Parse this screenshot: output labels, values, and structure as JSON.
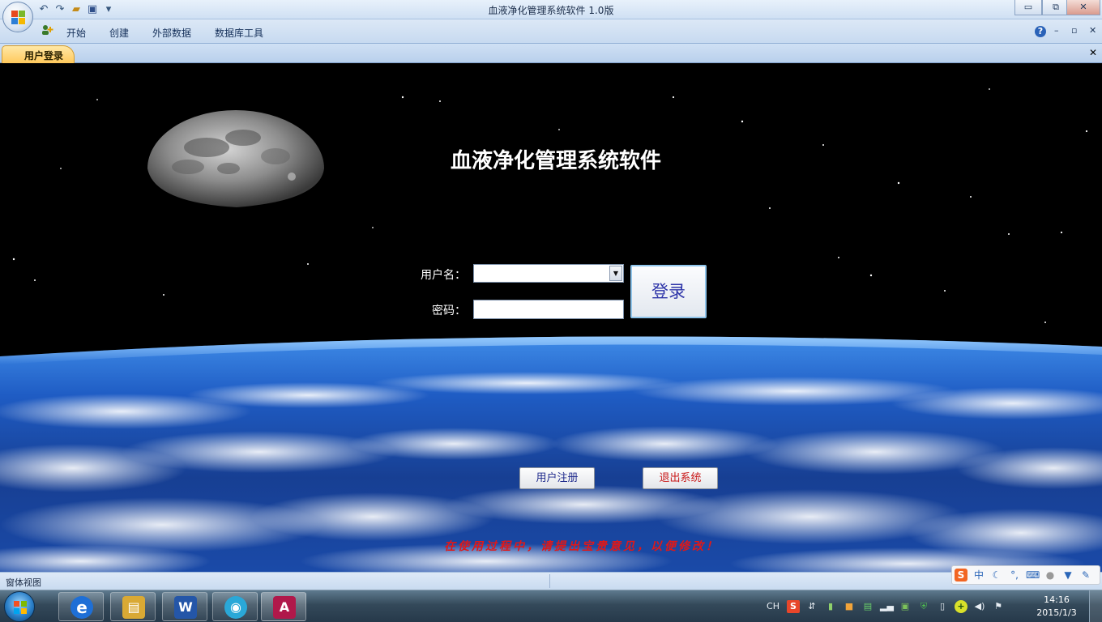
{
  "window": {
    "title": "血液净化管理系统软件 1.0版",
    "controls": {
      "minimize": "▭",
      "restore": "⧉",
      "close": "✕"
    }
  },
  "quick_access": [
    {
      "icon": "undo-icon",
      "glyph": "↶"
    },
    {
      "icon": "redo-icon",
      "glyph": "↷"
    },
    {
      "icon": "open-folder-icon",
      "glyph": "📂"
    },
    {
      "icon": "save-icon",
      "glyph": "💾"
    },
    {
      "icon": "customize-icon",
      "glyph": "▾"
    }
  ],
  "ribbon": {
    "tabs": [
      "开始",
      "创建",
      "外部数据",
      "数据库工具"
    ],
    "help_glyph": "?",
    "minimize_glyph": "–",
    "restore_glyph": "▫",
    "close_glyph": "✕"
  },
  "document_tabs": {
    "active": "用户登录",
    "close_glyph": "✕"
  },
  "form": {
    "title": "血液净化管理系统软件",
    "username_label": "用户名：",
    "password_label": "密码：",
    "username_value": "",
    "password_value": "",
    "login_button": "登录",
    "register_button": "用户注册",
    "exit_button": "退出系统",
    "note": "在使用过程中，请提出宝贵意见，以便修改！"
  },
  "status_bar": {
    "text": "窗体视图"
  },
  "ime_bar": {
    "logo": "S",
    "mode": "中",
    "icons": [
      "moon-icon",
      "punctuation-icon",
      "keyboard-icon",
      "user-icon",
      "skin-icon",
      "settings-icon"
    ]
  },
  "taskbar": {
    "apps": [
      {
        "name": "internet-explorer",
        "glyph": "e",
        "color": "#1e6fd6"
      },
      {
        "name": "file-explorer",
        "glyph": "▤",
        "color": "#d9a934"
      },
      {
        "name": "word",
        "glyph": "W",
        "color": "#2456a8"
      },
      {
        "name": "browser",
        "glyph": "◉",
        "color": "#2aa8d8"
      },
      {
        "name": "access",
        "glyph": "A",
        "color": "#b0184a"
      }
    ],
    "tray": {
      "language": "CH",
      "icons": [
        "sogou-icon",
        "network-switch-icon",
        "battery-icon",
        "app-icon",
        "chat-icon",
        "signal-icon",
        "network-icon",
        "shield-icon",
        "device-icon",
        "plus-icon",
        "volume-icon",
        "flag-icon"
      ]
    },
    "clock_time": "14:16",
    "clock_date": "2015/1/3"
  },
  "colors": {
    "note_red": "#e01818",
    "login_text_blue": "#2d34a8",
    "ribbon_blue": "#c7daf0",
    "active_tab_orange": "#ffc95c"
  }
}
